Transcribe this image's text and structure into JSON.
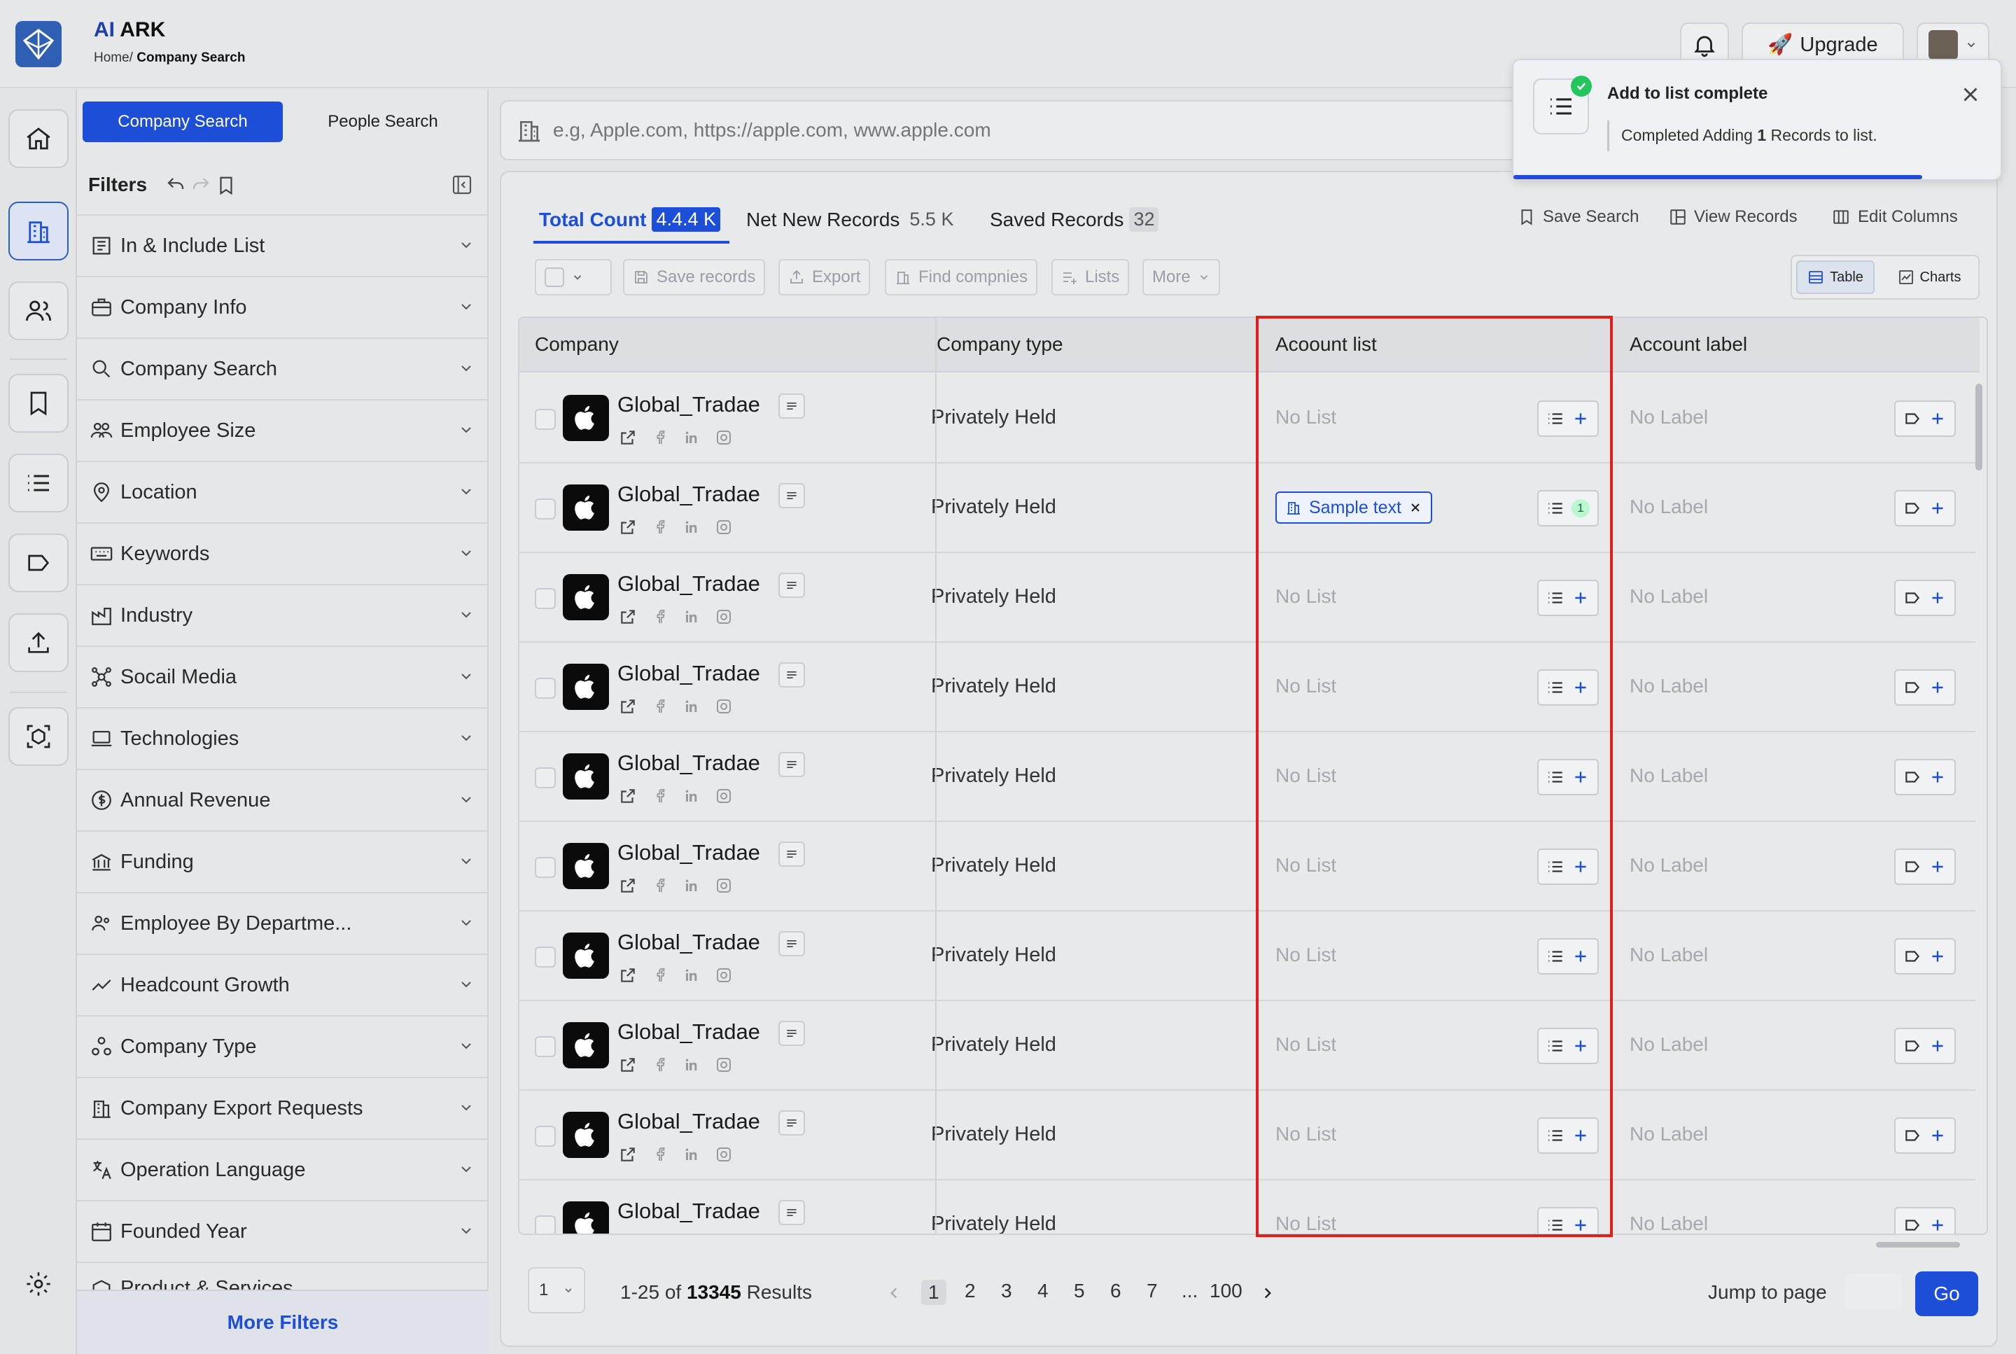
{
  "app": {
    "brand_ai": "AI",
    "brand_name": "ARK",
    "breadcrumb_home": "Home/",
    "breadcrumb_current": "Company Search"
  },
  "header": {
    "upgrade_label": "Upgrade"
  },
  "search_tabs": {
    "company": "Company Search",
    "people": "People Search"
  },
  "filters": {
    "title": "Filters",
    "items": [
      "In & Include List",
      "Company Info",
      "Company Search",
      "Employee Size",
      "Location",
      "Keywords",
      "Industry",
      "Socail Media",
      "Technologies",
      "Annual Revenue",
      "Funding",
      "Employee By Departme...",
      "Headcount Growth",
      "Company Type",
      "Company Export Requests",
      "Operation Language",
      "Founded Year",
      "Product & Services"
    ],
    "more_filters": "More Filters"
  },
  "search": {
    "placeholder": "e.g, Apple.com, https://apple.com, www.apple.com"
  },
  "tabs": [
    {
      "label": "Total Count",
      "count": "4.4.4 K"
    },
    {
      "label": "Net New Records",
      "count": "5.5 K"
    },
    {
      "label": "Saved Records",
      "count": "32"
    }
  ],
  "top_actions": {
    "save_search": "Save Search",
    "view_records": "View Records",
    "edit_columns": "Edit Columns"
  },
  "toolbar": {
    "save_records": "Save records",
    "export": "Export",
    "find_companies": "Find compnies",
    "lists": "Lists",
    "more": "More",
    "table": "Table",
    "charts": "Charts"
  },
  "table": {
    "columns": {
      "company": "Company",
      "company_type": "Company type",
      "account_list": "Acoount list",
      "account_label": "Account label"
    },
    "rows": [
      {
        "name": "Global_Tradae",
        "type": "Privately Held",
        "list": "No List",
        "label": "No Label"
      },
      {
        "name": "Global_Tradae",
        "type": "Privately Held",
        "list_tag": "Sample text",
        "list_count": "1",
        "label": "No Label"
      },
      {
        "name": "Global_Tradae",
        "type": "Privately Held",
        "list": "No List",
        "label": "No Label"
      },
      {
        "name": "Global_Tradae",
        "type": "Privately Held",
        "list": "No List",
        "label": "No Label"
      },
      {
        "name": "Global_Tradae",
        "type": "Privately Held",
        "list": "No List",
        "label": "No Label"
      },
      {
        "name": "Global_Tradae",
        "type": "Privately Held",
        "list": "No List",
        "label": "No Label"
      },
      {
        "name": "Global_Tradae",
        "type": "Privately Held",
        "list": "No List",
        "label": "No Label"
      },
      {
        "name": "Global_Tradae",
        "type": "Privately Held",
        "list": "No List",
        "label": "No Label"
      },
      {
        "name": "Global_Tradae",
        "type": "Privately Held",
        "list": "No List",
        "label": "No Label"
      },
      {
        "name": "Global_Tradae",
        "type": "Privately Held",
        "list": "No List",
        "label": "No Label"
      }
    ]
  },
  "pagination": {
    "per_page": "1",
    "range": "1-25 of",
    "total": "13345",
    "results_word": "Results",
    "pages": [
      "1",
      "2",
      "3",
      "4",
      "5",
      "6",
      "7",
      "...",
      "100"
    ],
    "jump_label": "Jump to page",
    "go": "Go"
  },
  "toast": {
    "title": "Add to list complete",
    "msg_prefix": "Completed Adding",
    "msg_count": "1",
    "msg_suffix": "Records to list."
  },
  "colors": {
    "primary": "#1d4ed8",
    "highlight": "#e11d1d",
    "success": "#22c55e"
  }
}
